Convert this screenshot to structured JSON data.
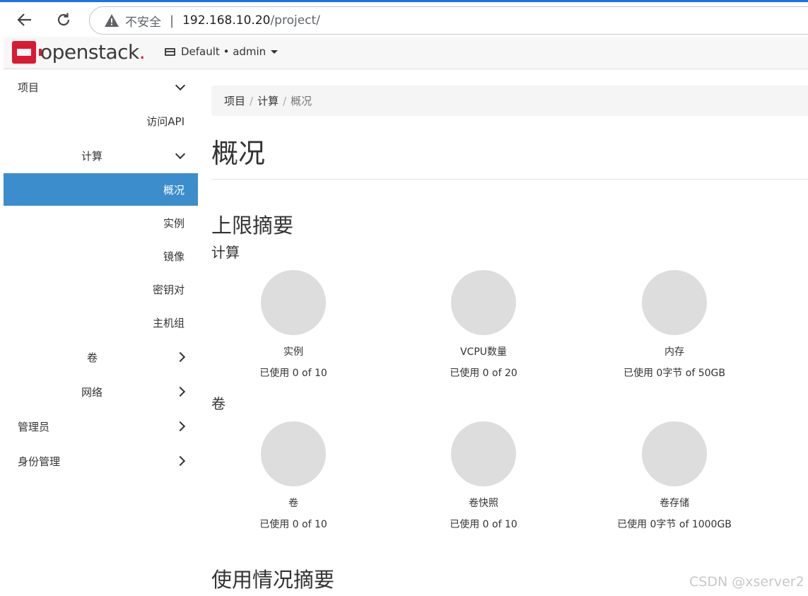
{
  "browser": {
    "not_secure": "不安全",
    "url_host": "192.168.10.20",
    "url_path": "/project/"
  },
  "header": {
    "logo_text": "openstack",
    "project_selector": "Default • admin"
  },
  "sidebar": {
    "items": [
      {
        "label": "项目"
      },
      {
        "label": "访问API"
      },
      {
        "label": "计算"
      },
      {
        "label": "概况"
      },
      {
        "label": "实例"
      },
      {
        "label": "镜像"
      },
      {
        "label": "密钥对"
      },
      {
        "label": "主机组"
      },
      {
        "label": "卷"
      },
      {
        "label": "网络"
      },
      {
        "label": "管理员"
      },
      {
        "label": "身份管理"
      }
    ]
  },
  "breadcrumb": [
    "项目",
    "计算",
    "概况"
  ],
  "page_title": "概况",
  "limit_summary": {
    "heading": "上限摘要",
    "compute": {
      "heading": "计算",
      "pies": [
        {
          "label": "实例",
          "usage": "已使用 0 of 10",
          "used_fraction": 0
        },
        {
          "label": "VCPU数量",
          "usage": "已使用 0 of 20",
          "used_fraction": 0
        },
        {
          "label": "内存",
          "usage": "已使用 0字节 of 50GB",
          "used_fraction": 0
        }
      ]
    },
    "volume": {
      "heading": "卷",
      "pies": [
        {
          "label": "卷",
          "usage": "已使用 0 of 10",
          "used_fraction": 0
        },
        {
          "label": "卷快照",
          "usage": "已使用 0 of 10",
          "used_fraction": 0
        },
        {
          "label": "卷存储",
          "usage": "已使用 0字节 of 1000GB",
          "used_fraction": 0
        }
      ]
    }
  },
  "usage_summary": {
    "heading": "使用情况摘要"
  },
  "watermark": "CSDN @xserver2"
}
